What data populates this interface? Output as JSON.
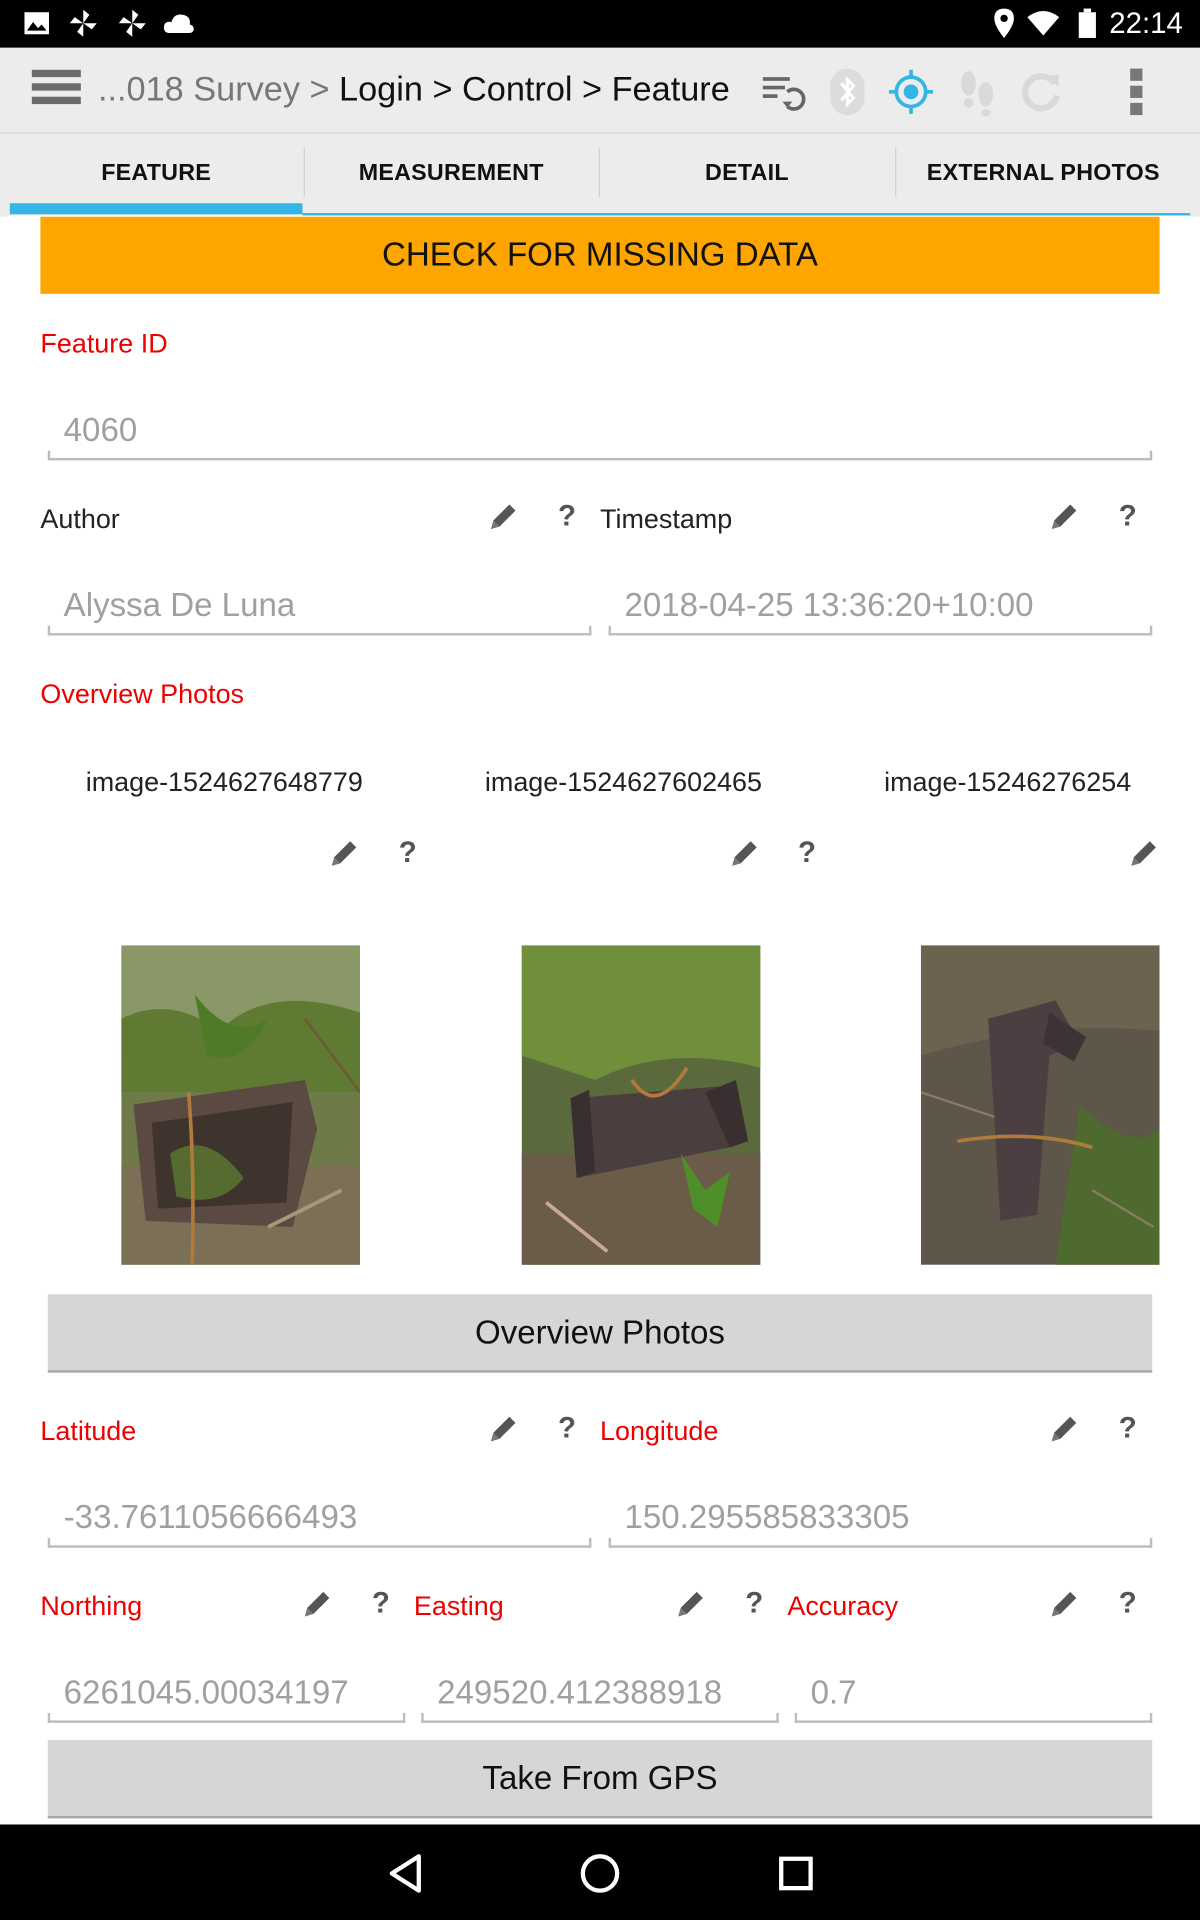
{
  "status_bar": {
    "time": "22:14"
  },
  "app_bar": {
    "breadcrumb": {
      "prefix": "...018 Survey >",
      "rest": " Login > Control > Feature"
    }
  },
  "tabs": [
    {
      "label": "FEATURE"
    },
    {
      "label": "MEASUREMENT"
    },
    {
      "label": "DETAIL"
    },
    {
      "label": "EXTERNAL PHOTOS"
    }
  ],
  "form": {
    "check_button": "CHECK FOR MISSING DATA",
    "feature_id": {
      "label": "Feature ID",
      "value": "4060"
    },
    "author": {
      "label": "Author",
      "value": "Alyssa De Luna"
    },
    "timestamp": {
      "label": "Timestamp",
      "value": "2018-04-25 13:36:20+10:00"
    },
    "overview_photos": {
      "label": "Overview Photos",
      "images": [
        {
          "name": "image-1524627648779"
        },
        {
          "name": "image-1524627602465"
        },
        {
          "name": "image-15246276254"
        }
      ],
      "button": "Overview Photos"
    },
    "latitude": {
      "label": "Latitude",
      "value": "-33.7611056666493"
    },
    "longitude": {
      "label": "Longitude",
      "value": "150.295585833305"
    },
    "northing": {
      "label": "Northing",
      "value": "6261045.00034197"
    },
    "easting": {
      "label": "Easting",
      "value": "249520.412388918"
    },
    "accuracy": {
      "label": "Accuracy",
      "value": "0.7"
    },
    "gps_button": "Take From GPS"
  },
  "help_glyph": "?",
  "colors": {
    "accent": "#33b5e5",
    "required_label": "#ee0000",
    "warning_button": "#ffa500"
  }
}
